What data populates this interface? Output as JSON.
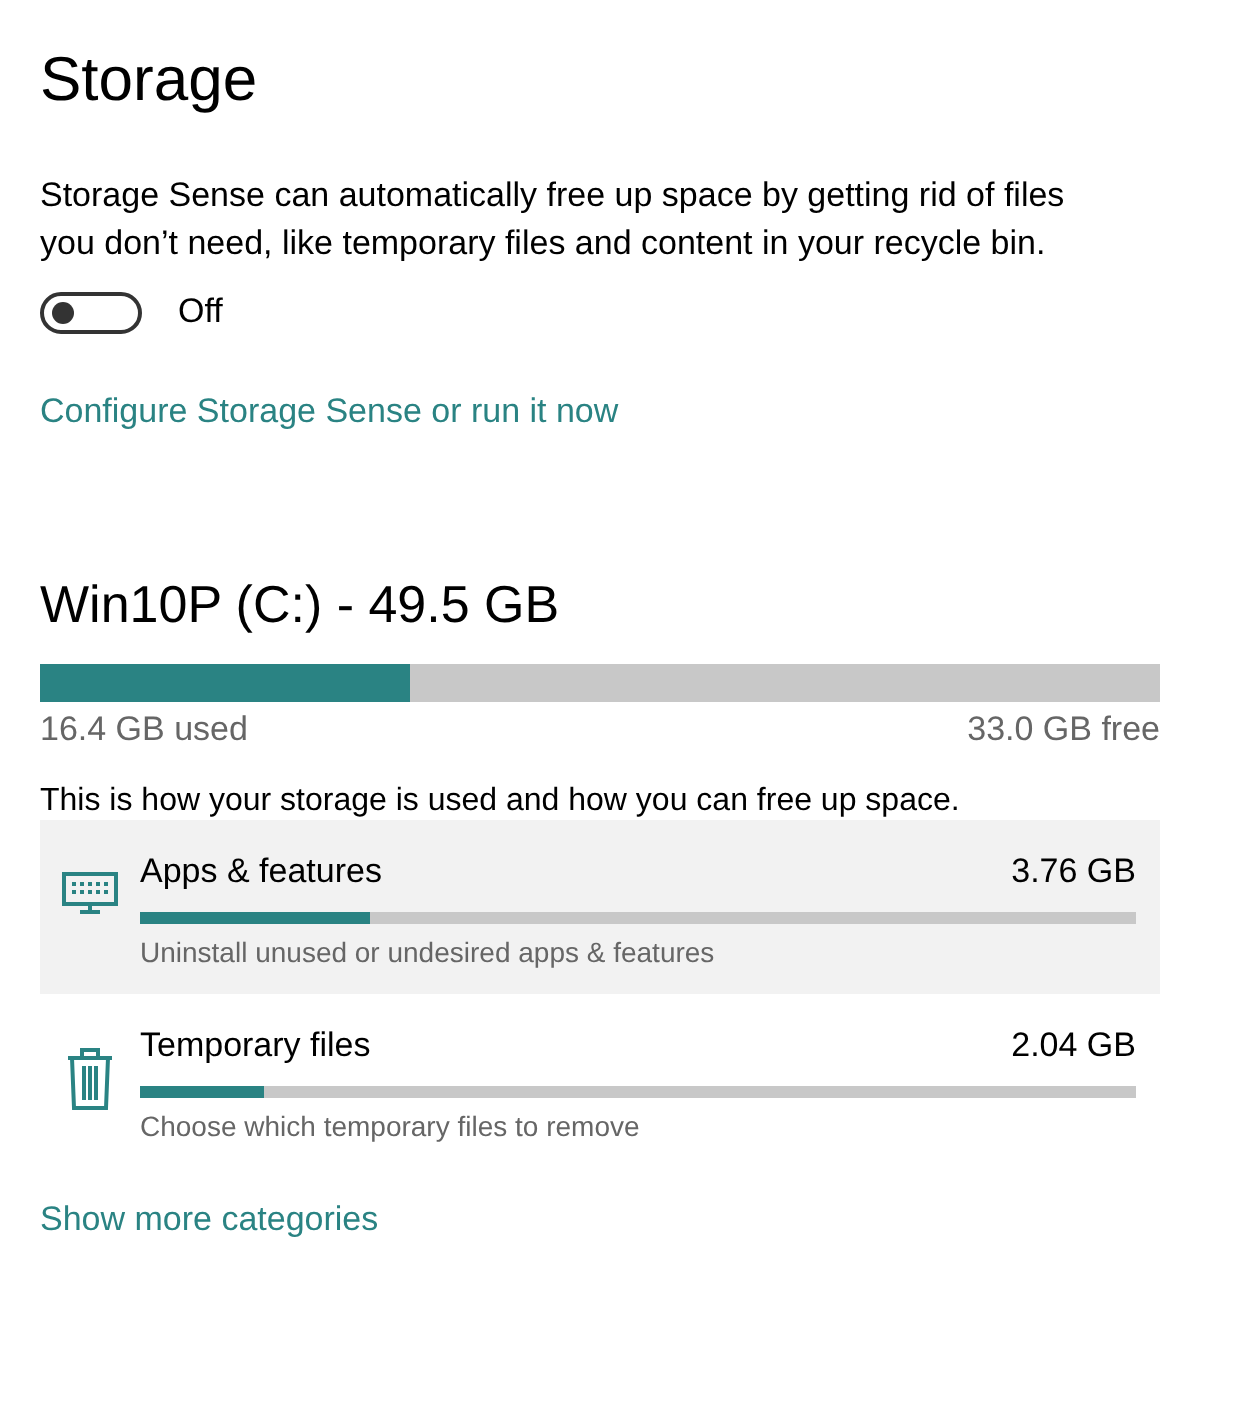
{
  "title": "Storage",
  "description": "Storage Sense can automatically free up space by getting rid of files you don’t need, like temporary files and content in your recycle bin.",
  "toggle": {
    "on": false,
    "label": "Off"
  },
  "configure_link": "Configure Storage Sense or run it now",
  "drive": {
    "name": "Win10P (C:) - 49.5 GB",
    "level": 0.33,
    "used": "16.4 GB used",
    "free": "33.0 GB free"
  },
  "usage_note": "This is how your storage is used and how you can free up space.",
  "categories": [
    {
      "kind": "apps",
      "name": "Apps & features",
      "size": "3.76 GB",
      "level": 0.23,
      "hint": "Uninstall unused or undesired apps & features",
      "selected": true
    },
    {
      "kind": "temp",
      "name": "Temporary files",
      "size": "2.04 GB",
      "level": 0.125,
      "hint": "Choose which temporary files to remove",
      "selected": false
    }
  ],
  "more_link": "Show more categories"
}
